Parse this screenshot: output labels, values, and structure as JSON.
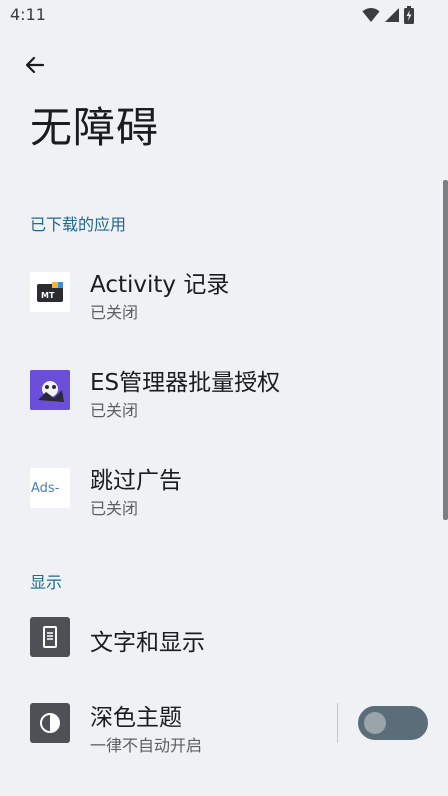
{
  "status_bar": {
    "time": "4:11"
  },
  "header": {
    "title": "无障碍"
  },
  "sections": {
    "downloaded": {
      "header": "已下载的应用",
      "items": [
        {
          "title": "Activity 记录",
          "subtitle": "已关闭",
          "icon": "mt-app-icon"
        },
        {
          "title": "ES管理器批量授权",
          "subtitle": "已关闭",
          "icon": "es-app-icon"
        },
        {
          "title": "跳过广告",
          "subtitle": "已关闭",
          "icon": "ads-app-icon",
          "icon_text": "Ads-"
        }
      ]
    },
    "display": {
      "header": "显示",
      "items": [
        {
          "title": "文字和显示",
          "icon": "text-display-icon"
        },
        {
          "title": "深色主题",
          "subtitle": "一律不自动开启",
          "icon": "dark-theme-icon",
          "toggle_on": false
        }
      ]
    }
  },
  "colors": {
    "accent": "#1f6a8a",
    "background": "#f0f1f4",
    "icon_bg": "#4d5156"
  }
}
